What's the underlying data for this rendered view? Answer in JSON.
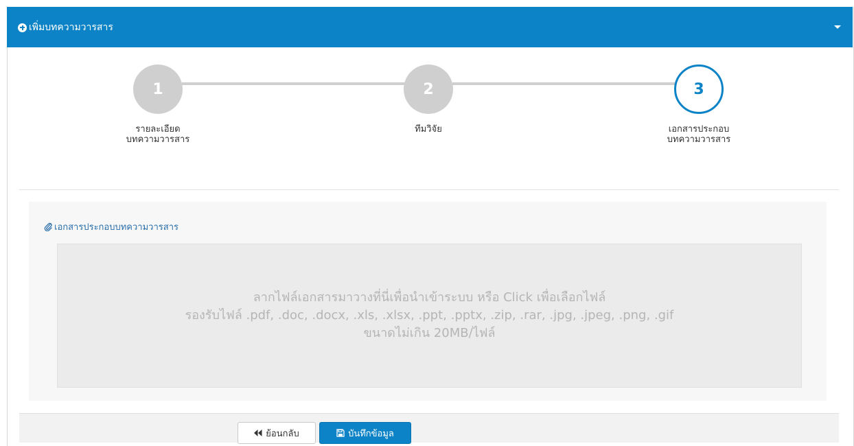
{
  "panel": {
    "title": "เพิ่มบทความวารสาร",
    "header_color": "#0b83c6"
  },
  "steps": [
    {
      "number": "1",
      "label": "รายละเอียด\nบทความวารสาร",
      "state": "done"
    },
    {
      "number": "2",
      "label": "ทีมวิจัย",
      "state": "done"
    },
    {
      "number": "3",
      "label": "เอกสารประกอบ\nบทความวารสาร",
      "state": "active"
    }
  ],
  "documents": {
    "section_title": "เอกสารประกอบบทความวารสาร",
    "dropzone_line1": "ลากไฟล์เอกสารมาวางที่นี่เพื่อนำเข้าระบบ หรือ Click เพื่อเลือกไฟล์",
    "dropzone_line2": "รองรับไฟล์ .pdf, .doc, .docx, .xls, .xlsx, .ppt, .pptx, .zip, .rar, .jpg, .jpeg, .png, .gif",
    "dropzone_line3": "ขนาดไม่เกิน 20MB/ไฟล์"
  },
  "buttons": {
    "back_label": "ย้อนกลับ",
    "save_label": "บันทึกข้อมูล"
  },
  "icons": {
    "header": "plus-circle-icon",
    "collapse": "caret-down-icon",
    "section": "paperclip-icon",
    "back": "double-chevron-left-icon",
    "save": "floppy-disk-icon"
  }
}
